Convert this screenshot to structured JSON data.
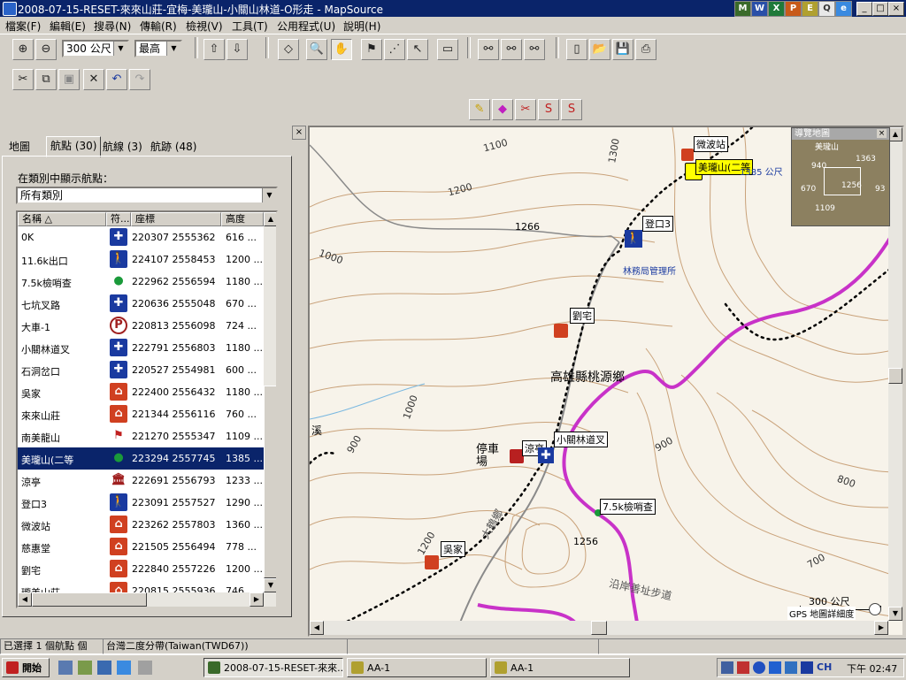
{
  "window": {
    "title": "2008-07-15-RESET-來來山莊-宜梅-美瓏山-小關山林道-O形走 - MapSource"
  },
  "menu": [
    "檔案(F)",
    "編輯(E)",
    "搜尋(N)",
    "傳輸(R)",
    "檢視(V)",
    "工具(T)",
    "公用程式(U)",
    "說明(H)"
  ],
  "toolbar": {
    "scale_value": "300 公尺",
    "detail_value": "最高"
  },
  "tabs": [
    "地圖",
    "航點 (30)",
    "航線 (3)",
    "航跡 (48)"
  ],
  "panel": {
    "category_label": "在類別中顯示航點：",
    "category_value": "所有類別"
  },
  "table": {
    "headers": [
      "名稱",
      "符...",
      "座標",
      "高度"
    ],
    "rows": [
      {
        "name": "0K",
        "sym": "cross",
        "coord": "220307 2555362",
        "alt": "616 ..."
      },
      {
        "name": "11.6k出口",
        "sym": "hiker",
        "coord": "224107 2558453",
        "alt": "1200 ..."
      },
      {
        "name": "7.5k檢哨查",
        "sym": "dot",
        "coord": "222962 2556594",
        "alt": "1180 ..."
      },
      {
        "name": "七坑叉路",
        "sym": "cross",
        "coord": "220636 2555048",
        "alt": "670 ..."
      },
      {
        "name": "大車-1",
        "sym": "parking",
        "coord": "220813 2556098",
        "alt": "724 ..."
      },
      {
        "name": "小關林道叉",
        "sym": "cross",
        "coord": "222791 2556803",
        "alt": "1180 ..."
      },
      {
        "name": "石洞岔口",
        "sym": "cross",
        "coord": "220527 2554981",
        "alt": "600 ..."
      },
      {
        "name": "吳家",
        "sym": "house",
        "coord": "222400 2556432",
        "alt": "1180 ..."
      },
      {
        "name": "來來山莊",
        "sym": "house",
        "coord": "221344 2556116",
        "alt": "760 ..."
      },
      {
        "name": "南美龍山",
        "sym": "flag",
        "coord": "221270 2555347",
        "alt": "1109 ..."
      },
      {
        "name": "美瓏山(二等",
        "sym": "dot",
        "coord": "223294 2557745",
        "alt": "1385 ...",
        "selected": true
      },
      {
        "name": "涼亭",
        "sym": "building",
        "coord": "222691 2556793",
        "alt": "1233 ..."
      },
      {
        "name": "登口3",
        "sym": "hiker",
        "coord": "223091 2557527",
        "alt": "1290 ..."
      },
      {
        "name": "微波站",
        "sym": "house",
        "coord": "223262 2557803",
        "alt": "1360 ..."
      },
      {
        "name": "慈惠堂",
        "sym": "house",
        "coord": "221505 2556494",
        "alt": "778 ..."
      },
      {
        "name": "劉宅",
        "sym": "house",
        "coord": "222840 2557226",
        "alt": "1200 ..."
      },
      {
        "name": "瓏美山莊",
        "sym": "house",
        "coord": "220815 2555936",
        "alt": "746 ..."
      }
    ]
  },
  "map": {
    "labels": {
      "microwave": "微波站",
      "peak": "美瓏山(二等",
      "peak_alt": "1385 公尺",
      "trailhead": "登口3",
      "forestry": "林務局管理所",
      "liu": "劉宅",
      "township": "高雄縣桃源鄉",
      "parking": "停車場",
      "pavilion": "涼亭",
      "junction": "小關林道叉",
      "checkpoint": "7.5k檢哨查",
      "wu": "吳家",
      "trail": "沿岸善址步道",
      "road": "大鶴鄉",
      "stream": "溪"
    },
    "contours": [
      "1100",
      "1300",
      "1200",
      "1266",
      "1000",
      "1000",
      "900",
      "1256",
      "1200",
      "900",
      "800",
      "700"
    ],
    "scale_label": "300 公尺",
    "detail_label": "GPS 地圖詳細度",
    "overview": {
      "title": "導覽地圖",
      "labels": [
        "美瓏山",
        "940",
        "1363",
        "670",
        "1256",
        "93",
        "1109"
      ]
    }
  },
  "status": {
    "selected": "已選擇 1 個航點 個",
    "datum": "台灣二度分帶(Taiwan(TWD67))"
  },
  "taskbar": {
    "start": "開始",
    "tasks": [
      "2008-07-15-RESET-來來...",
      "AA-1",
      "AA-1"
    ],
    "ime": "CH",
    "clock": "下午 02:47"
  }
}
